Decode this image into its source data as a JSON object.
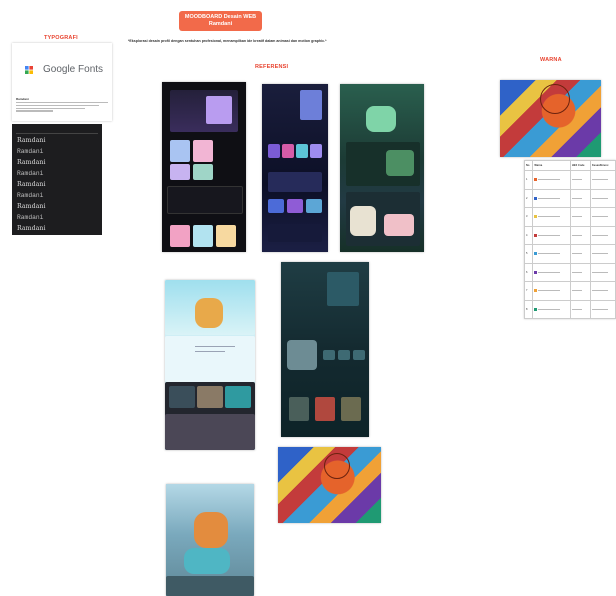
{
  "header": {
    "title_line1": "MOODBOARD Desain WEB",
    "title_line2": "Ramdani",
    "subtitle": "*Eksplorasi desain profil dengan sentuhan profesional, menampilkan ide kreatif dalam animasi dan motion graphic.*"
  },
  "sections": {
    "typography": "TYPOGRAFI",
    "reference": "REFERENSI",
    "color": "WARNA"
  },
  "typography": {
    "google_fonts": "Google Fonts",
    "font_sample": "Ramdani",
    "font_rows": [
      "Ramdani",
      "Ramdani",
      "Ramdani",
      "Ramdani",
      "Ramdani",
      "Ramdani",
      "Ramdani",
      "Ramdani",
      "Ramdani",
      "Ramdani"
    ]
  },
  "color_table": {
    "headers": [
      "No",
      "Warna",
      "HEX Code",
      "Kesan/Emosi"
    ],
    "rows": [
      {
        "no": "1",
        "color": "#e8632b"
      },
      {
        "no": "2",
        "color": "#2f62c8"
      },
      {
        "no": "3",
        "color": "#e9c342"
      },
      {
        "no": "4",
        "color": "#c33b3b"
      },
      {
        "no": "5",
        "color": "#3a9bd4"
      },
      {
        "no": "6",
        "color": "#6b3aa8"
      },
      {
        "no": "7",
        "color": "#f0a136"
      },
      {
        "no": "8",
        "color": "#1f9a73"
      }
    ]
  },
  "colors": {
    "accent": "#f26a4a",
    "heading": "#e8432f"
  }
}
